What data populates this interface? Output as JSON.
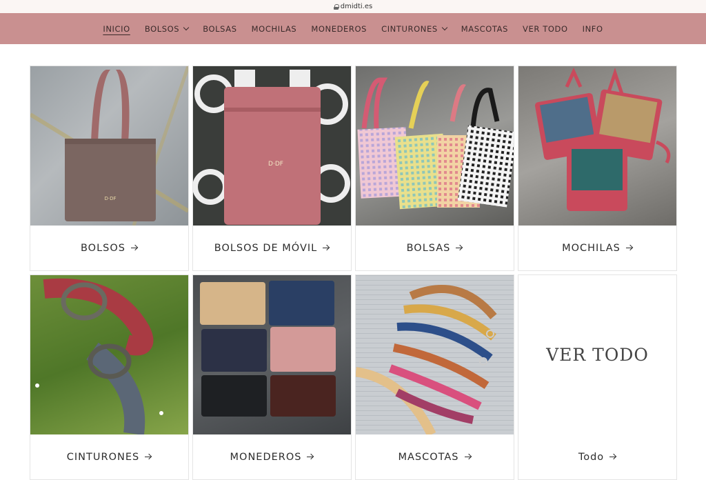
{
  "browser": {
    "url": "dmidti.es"
  },
  "nav": {
    "items": [
      {
        "label": "INICIO",
        "active": true,
        "dropdown": false
      },
      {
        "label": "BOLSOS",
        "active": false,
        "dropdown": true
      },
      {
        "label": "BOLSAS",
        "active": false,
        "dropdown": false
      },
      {
        "label": "MOCHILAS",
        "active": false,
        "dropdown": false
      },
      {
        "label": "MONEDEROS",
        "active": false,
        "dropdown": false
      },
      {
        "label": "CINTURONES",
        "active": false,
        "dropdown": true
      },
      {
        "label": "MASCOTAS",
        "active": false,
        "dropdown": false
      },
      {
        "label": "VER TODO",
        "active": false,
        "dropdown": false
      },
      {
        "label": "INFO",
        "active": false,
        "dropdown": false
      }
    ],
    "bg_color": "#c99090"
  },
  "collections": [
    {
      "label": "BOLSOS",
      "image": "brown-tote-bag"
    },
    {
      "label": "BOLSOS DE MÓVIL",
      "image": "pink-phone-bag"
    },
    {
      "label": "BOLSAS",
      "image": "gingham-tote-bags"
    },
    {
      "label": "MOCHILAS",
      "image": "floral-backpacks"
    },
    {
      "label": "CINTURONES",
      "image": "belts-on-grass"
    },
    {
      "label": "MONEDEROS",
      "image": "leather-coin-purses"
    },
    {
      "label": "MASCOTAS",
      "image": "pet-collars"
    },
    {
      "label": "Todo",
      "image": "",
      "placeholder_text": "VER TODO"
    }
  ]
}
